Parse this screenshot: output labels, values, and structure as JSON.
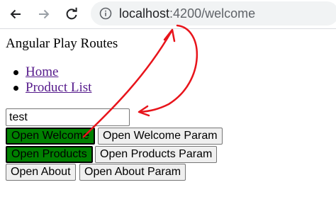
{
  "browser": {
    "back_icon": "arrow-left-icon",
    "forward_icon": "arrow-right-icon",
    "reload_icon": "reload-icon",
    "site_info_icon": "info-icon",
    "url_host": "localhost",
    "url_path": ":4200/welcome"
  },
  "app": {
    "title": "Angular Play Routes",
    "nav_links": [
      {
        "label": "Home"
      },
      {
        "label": "Product List"
      }
    ],
    "input_value": "test",
    "buttons": {
      "open_welcome": "Open Welcome",
      "open_welcome_param": "Open Welcome Param",
      "open_products": "Open Products",
      "open_products_param": "Open Products Param",
      "open_about": "Open About",
      "open_about_param": "Open About Param"
    }
  },
  "colors": {
    "active_button": "#008000",
    "link": "#551a8b",
    "annotation": "#e8141b"
  }
}
